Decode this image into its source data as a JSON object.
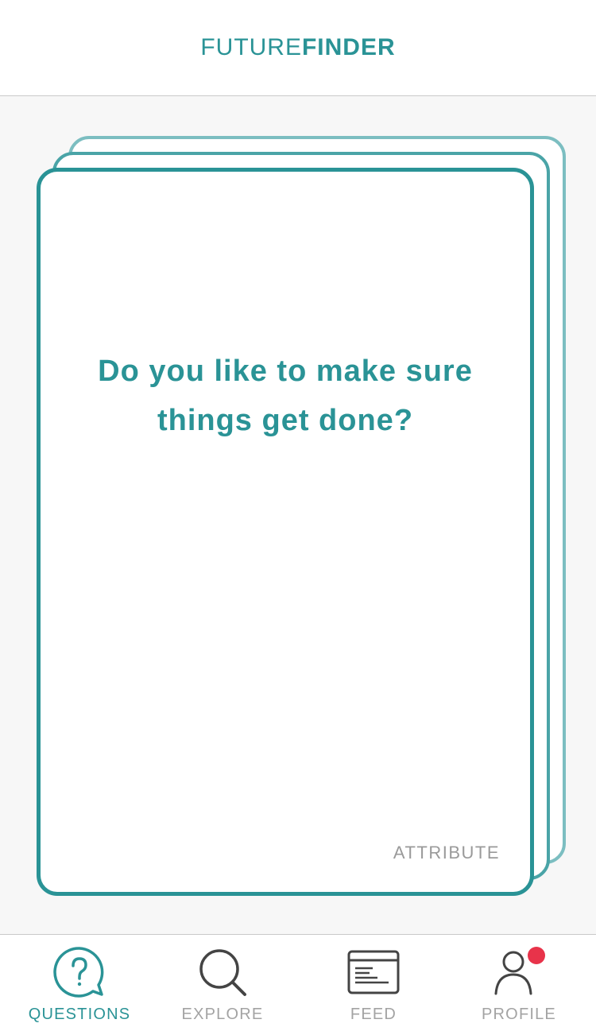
{
  "header": {
    "logo_light": "FUTURE",
    "logo_bold": "FINDER"
  },
  "card": {
    "question": "Do you like to make sure things get done?",
    "attribute_label": "ATTRIBUTE"
  },
  "tabs": [
    {
      "label": "QUESTIONS",
      "icon": "question-bubble-icon",
      "active": true
    },
    {
      "label": "EXPLORE",
      "icon": "search-icon",
      "active": false
    },
    {
      "label": "FEED",
      "icon": "feed-icon",
      "active": false
    },
    {
      "label": "PROFILE",
      "icon": "profile-icon",
      "active": false,
      "notification_dot": true
    }
  ],
  "colors": {
    "accent": "#2a9396",
    "inactive": "#a3a3a3",
    "icon": "#444444",
    "notification": "#e8334a"
  }
}
